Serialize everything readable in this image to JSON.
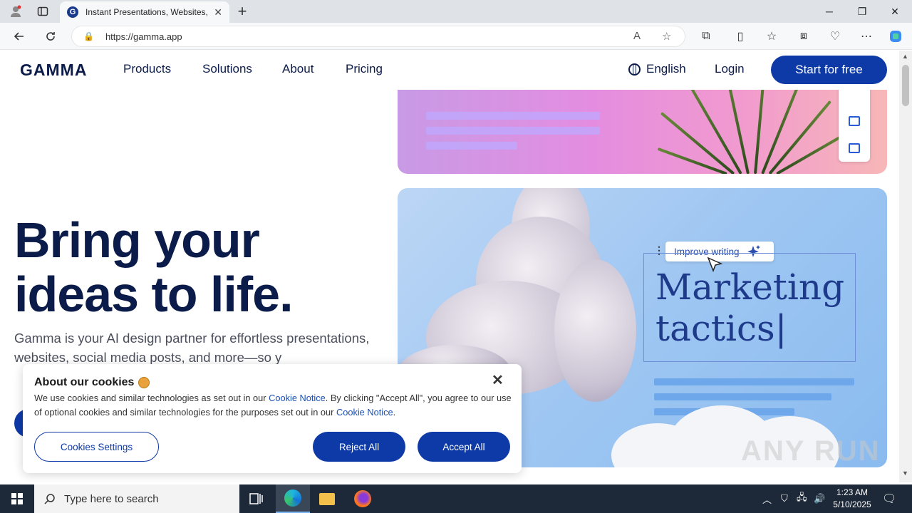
{
  "browser": {
    "tab_title": "Instant Presentations, Websites, a",
    "tab_favicon": "G",
    "url": "https://gamma.app"
  },
  "nav": {
    "logo": "GAMMA",
    "links": [
      "Products",
      "Solutions",
      "About",
      "Pricing"
    ],
    "language": "English",
    "login": "Login",
    "cta": "Start for free"
  },
  "hero": {
    "title_line1": "Bring your",
    "title_line2": "ideas to life.",
    "subtitle": "Gamma is your AI design partner for effortless presentations, websites, social media posts, and more—so y"
  },
  "showcase": {
    "improve_label": "Improve writing",
    "heading_line1": "Marketing",
    "heading_line2": "tactics"
  },
  "cookie": {
    "title": "About our cookies",
    "body_pre": "We use cookies and similar technologies as set out in our ",
    "link1": "Cookie Notice",
    "body_mid": ". By clicking \"Accept All\", you agree to our use of optional cookies and similar technologies for the purposes set out in our ",
    "link2": "Cookie Notice",
    "body_post": ".",
    "settings": "Cookies Settings",
    "reject": "Reject All",
    "accept": "Accept All"
  },
  "watermark": "ANY RUN",
  "taskbar": {
    "search_placeholder": "Type here to search",
    "time": "1:23 AM",
    "date": "5/10/2025"
  },
  "colors": {
    "brand_navy": "#0c1c4a",
    "brand_blue": "#0e3aa8"
  }
}
